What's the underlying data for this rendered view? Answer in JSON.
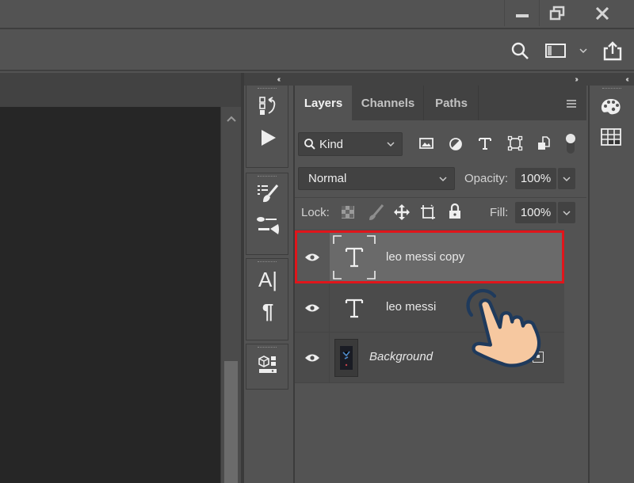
{
  "window": {
    "minimize_icon": "minimize-icon",
    "restore_icon": "restore-icon",
    "close_icon": "close-icon"
  },
  "options_bar": {
    "icons": [
      "search-icon",
      "workspace-layout-icon",
      "chevron-down-icon",
      "share-icon"
    ]
  },
  "panels": {
    "collapse_left": "‹‹",
    "expand_right": "››",
    "collapse_far": "‹‹"
  },
  "tool_column": {
    "groups": [
      {
        "tools": [
          "history-icon",
          "play-action-icon"
        ]
      },
      {
        "tools": [
          "brush-presets-icon",
          "brush-settings-icon"
        ]
      },
      {
        "tools": [
          "character-icon",
          "paragraph-icon"
        ]
      },
      {
        "tools": [
          "3d-libraries-icon"
        ]
      }
    ]
  },
  "layers_panel": {
    "tabs": [
      {
        "label": "Layers",
        "active": true
      },
      {
        "label": "Channels",
        "active": false
      },
      {
        "label": "Paths",
        "active": false
      }
    ],
    "menu_icon": "panel-menu-icon",
    "filter": {
      "kind_label": "Kind",
      "filter_icons": [
        "image-filter-icon",
        "adjustment-filter-icon",
        "type-filter-icon",
        "shape-filter-icon",
        "smart-object-filter-icon",
        "filter-toggle-icon"
      ]
    },
    "blend_mode": "Normal",
    "opacity_label": "Opacity:",
    "opacity_value": "100%",
    "lock_label": "Lock:",
    "lock_icons": [
      "lock-transparent-icon",
      "lock-image-icon",
      "lock-position-icon",
      "lock-artboard-icon",
      "lock-all-icon"
    ],
    "fill_label": "Fill:",
    "fill_value": "100%",
    "layers": [
      {
        "name": "leo messi  copy",
        "type": "text",
        "selected": true,
        "visible": true
      },
      {
        "name": "leo messi",
        "type": "text",
        "selected": false,
        "visible": true
      },
      {
        "name": "Background",
        "type": "image",
        "selected": false,
        "visible": true,
        "locked": true
      }
    ],
    "highlight_color": "#e0151b"
  },
  "right_column": {
    "icons": [
      "swatches-palette-icon",
      "grid-icon"
    ]
  },
  "overlay": {
    "pointer": "tap-hand-icon"
  }
}
